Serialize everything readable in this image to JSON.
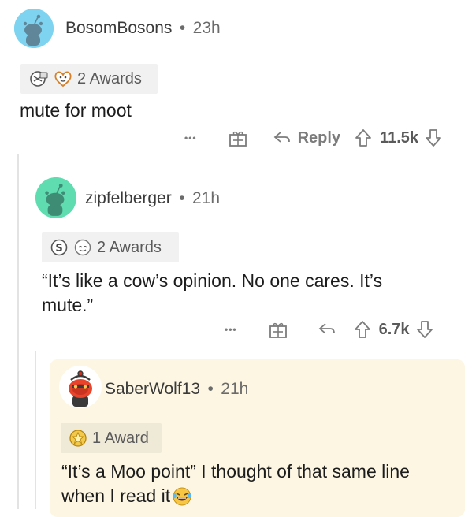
{
  "comments": [
    {
      "username": "BosomBosons",
      "time": "23h",
      "awards_label": "2 Awards",
      "text": "mute for moot",
      "more": "•••",
      "reply_label": "Reply",
      "votes": "11.5k",
      "avatar_color": "#7dd3f0"
    },
    {
      "username": "zipfelberger",
      "time": "21h",
      "awards_label": "2 Awards",
      "text_line1": "“It’s like a cow’s opinion. No one cares. It’s",
      "text_line2": "mute.”",
      "more": "•••",
      "votes": "6.7k",
      "avatar_color": "#5fdcb0"
    },
    {
      "username": "SaberWolf13",
      "time": "21h",
      "awards_label": "1 Award",
      "text_line1": "“It’s a Moo point” I thought of that same line",
      "text_line2": "when I read it",
      "highlight_color": "#fcf6e3"
    }
  ],
  "separator": "•"
}
